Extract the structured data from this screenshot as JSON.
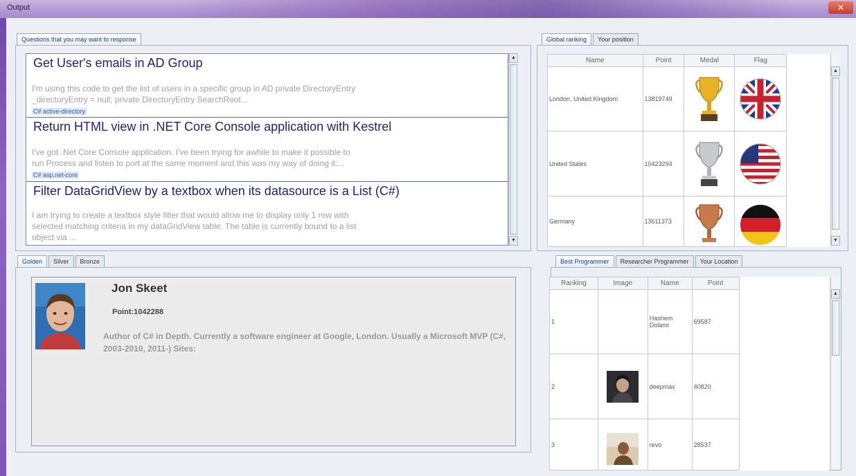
{
  "window": {
    "title": "Output",
    "close_glyph": "✕"
  },
  "questions_tab": "Questions that you may want to response",
  "questions": [
    {
      "title": "Get User's emails in AD Group",
      "excerpt_lines": [
        "I'm using this code to get the list of users in a specific group in AD private DirectoryEntry",
        "_directoryEntry = null; private DirectoryEntry SearchRoot..."
      ],
      "tags": "C# active-directory"
    },
    {
      "title": "Return HTML view in .NET Core Console application with Kestrel",
      "excerpt_lines": [
        "I've got .Net Core Console application. I've been trying for awhile to make it possible to",
        "run Process and listen to port at the same moment and this was my way of doing it:..."
      ],
      "tags": "C# asp.net-core"
    },
    {
      "title": "Filter DataGridView by a textbox when its datasource is a List (C#)",
      "excerpt_lines": [
        "I am trying to create a textbox style filter that would allow me to display only 1 row with",
        "selected matching criteria in my dataGridView table. The table is currently bound to a list",
        "object via ..."
      ],
      "tags": ""
    }
  ],
  "ranking": {
    "tabs": [
      "Global ranking",
      "Your position"
    ],
    "columns": [
      "Name",
      "Point",
      "Medal",
      "Flag"
    ],
    "rows": [
      {
        "name": "London, United Kingdom",
        "point": "13819749",
        "medal": "gold-trophy-icon",
        "flag": "uk-flag-icon"
      },
      {
        "name": "United States",
        "point": "10423294",
        "medal": "silver-trophy-icon",
        "flag": "us-flag-icon"
      },
      {
        "name": "Germany",
        "point": "13611373",
        "medal": "bronze-trophy-icon",
        "flag": "germany-flag-icon"
      }
    ]
  },
  "medal_tabs": [
    "Golden",
    "Silver",
    "Bronze"
  ],
  "profile": {
    "name": "Jon Skeet",
    "point": "Point:1042288",
    "bio": "Author of C# in Depth. Currently a software engineer at Google, London. Usually a Microsoft MVP (C#, 2003-2010, 2011-) Sites:"
  },
  "programmers": {
    "tabs": [
      "Best Programmer",
      "Researcher Programmer",
      "Your Location"
    ],
    "columns": [
      "Ranking",
      "Image",
      "Name",
      "Point"
    ],
    "rows": [
      {
        "ranking": "1",
        "image": "",
        "name": "Hashem Dolami",
        "point": "69587"
      },
      {
        "ranking": "2",
        "image": "avatar",
        "name": "deepmax",
        "point": "40820"
      },
      {
        "ranking": "3",
        "image": "avatar",
        "name": "revo",
        "point": "28537"
      }
    ]
  },
  "colors": {
    "accent": "#22226b",
    "tag_bg": "#d8e5f6",
    "gold": "#e8b227",
    "silver": "#b0b4ba",
    "bronze": "#c77a4c"
  }
}
